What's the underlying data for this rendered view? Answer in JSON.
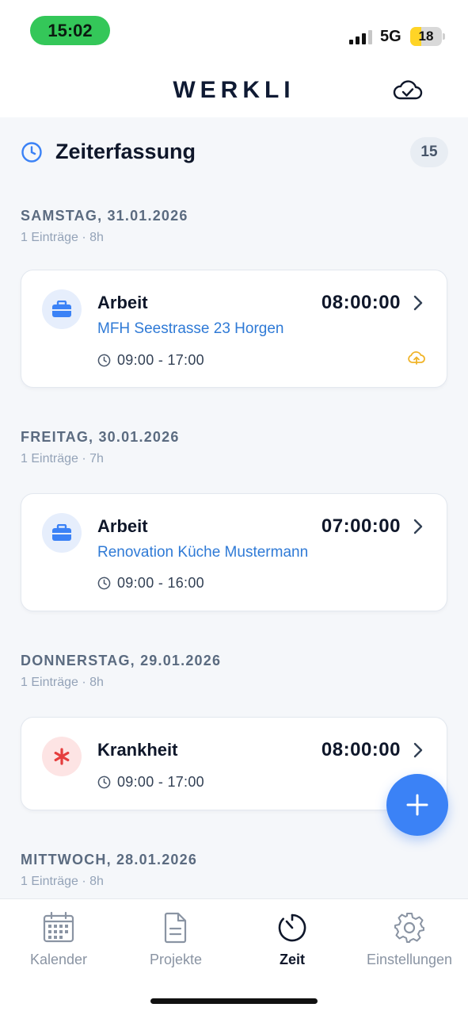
{
  "status_bar": {
    "time": "15:02",
    "network": "5G",
    "battery": "18",
    "battery_level": 0.18,
    "battery_color": "#ffd426",
    "time_pill_color": "#34c759"
  },
  "header": {
    "brand": "WERKLI",
    "sync_icon": "cloud-check-icon"
  },
  "section": {
    "title": "Zeiterfassung",
    "count": "15",
    "icon": "clock-icon"
  },
  "days": [
    {
      "title": "SAMSTAG, 31.01.2026",
      "summary": "1 Einträge · 8h",
      "entry": {
        "type": "Arbeit",
        "icon": "briefcase-icon",
        "duration": "08:00:00",
        "project": "MFH Seestrasse 23 Horgen",
        "time_range": "09:00 - 17:00",
        "pending_upload": true
      }
    },
    {
      "title": "FREITAG, 30.01.2026",
      "summary": "1 Einträge · 7h",
      "entry": {
        "type": "Arbeit",
        "icon": "briefcase-icon",
        "duration": "07:00:00",
        "project": "Renovation Küche Mustermann",
        "time_range": "09:00 - 16:00"
      }
    },
    {
      "title": "DONNERSTAG, 29.01.2026",
      "summary": "1 Einträge · 8h",
      "entry": {
        "type": "Krankheit",
        "icon": "asterisk-icon",
        "duration": "08:00:00",
        "time_range": "09:00 - 17:00"
      }
    },
    {
      "title": "MITTWOCH, 28.01.2026",
      "summary": "1 Einträge · 8h"
    }
  ],
  "fab": {
    "icon": "plus-icon"
  },
  "tabs": [
    {
      "label": "Kalender",
      "icon": "calendar-icon",
      "active": false
    },
    {
      "label": "Projekte",
      "icon": "document-icon",
      "active": false
    },
    {
      "label": "Zeit",
      "icon": "timer-icon",
      "active": true
    },
    {
      "label": "Einstellungen",
      "icon": "gear-icon",
      "active": false
    }
  ],
  "colors": {
    "accent": "#3b82f6",
    "link": "#2f7ad6",
    "work_icon_bg": "#e6eefc",
    "sick_icon_bg": "#fde4e4",
    "sick_icon": "#e53e3e",
    "upload_pending": "#f0b429"
  }
}
